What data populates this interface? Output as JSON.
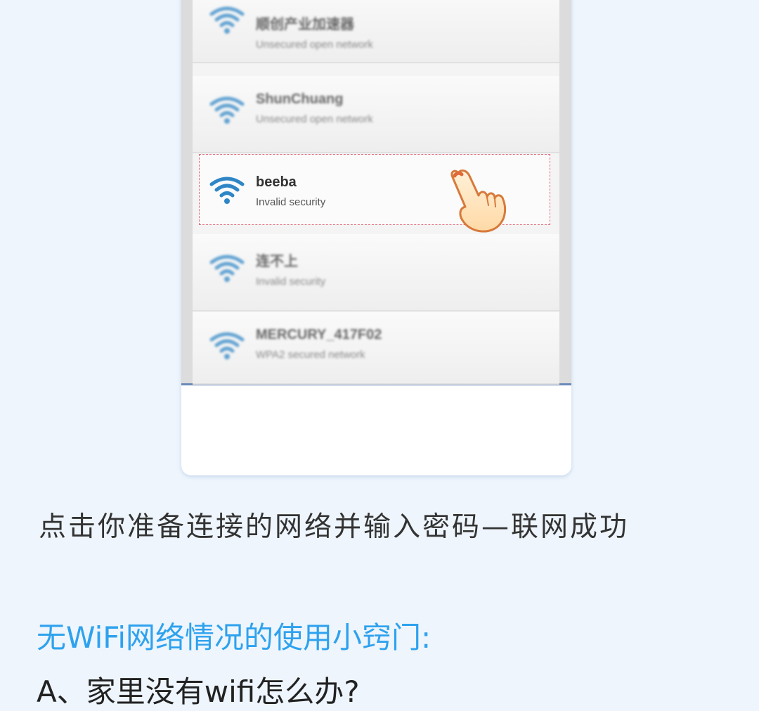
{
  "networks": [
    {
      "name": "顺创产业加速器",
      "status": "Unsecured open network"
    },
    {
      "name": "ShunChuang",
      "status": "Unsecured open network"
    },
    {
      "name": "beeba",
      "status": "Invalid security"
    },
    {
      "name": "连不上",
      "status": "Invalid security"
    },
    {
      "name": "MERCURY_417F02",
      "status": "WPA2 secured network"
    }
  ],
  "icons": {
    "wifi": "wifi-icon",
    "pointer": "pointing-hand-icon"
  },
  "colors": {
    "wifi_blue": "#2f86c6",
    "highlight_dash": "#e06a7a",
    "tip_title": "#2ea2ee"
  },
  "caption": "点击你准备连接的网络并输入密码—联网成功",
  "tip": {
    "title": "无WiFi网络情况的使用小窍门:",
    "question_a": "A、家里没有wifi怎么办?"
  }
}
